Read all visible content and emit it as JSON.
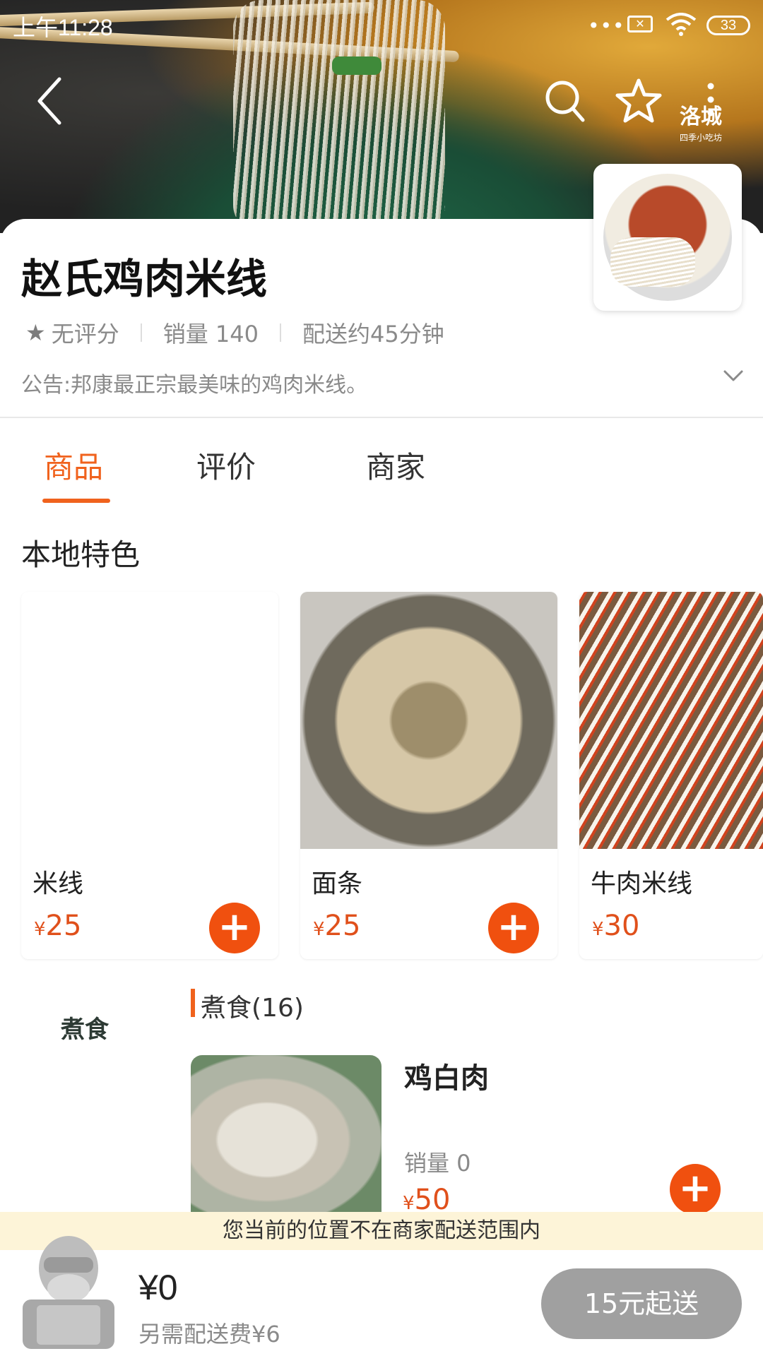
{
  "status_bar": {
    "time": "上午11:28",
    "battery": "33"
  },
  "header": {
    "brand_logo_text": "洛城",
    "brand_logo_sub": "四季小吃坊"
  },
  "store": {
    "name": "赵氏鸡肉米线",
    "rating": "无评分",
    "sales": "销量 140",
    "delivery_time": "配送约45分钟",
    "notice": "公告:邦康最正宗最美味的鸡肉米线。"
  },
  "tabs": [
    {
      "label": "商品",
      "active": true
    },
    {
      "label": "评价",
      "active": false
    },
    {
      "label": "商家",
      "active": false
    }
  ],
  "featured": {
    "title": "本地特色",
    "items": [
      {
        "name": "米线",
        "currency": "¥",
        "price": "25"
      },
      {
        "name": "面条",
        "currency": "¥",
        "price": "25"
      },
      {
        "name": "牛肉米线",
        "currency": "¥",
        "price": "30"
      }
    ]
  },
  "menu": {
    "sidebar": [
      {
        "label": "煮食"
      }
    ],
    "category_title": "煮食(16)",
    "items": [
      {
        "name": "鸡白肉",
        "sales": "销量 0",
        "currency": "¥",
        "price": "50"
      }
    ]
  },
  "cart": {
    "range_notice": "您当前的位置不在商家配送范围内",
    "total": "¥0",
    "extra_fee": "另需配送费¥6",
    "checkout_label": "15元起送"
  },
  "colors": {
    "accent": "#f0621d",
    "price": "#e0501b",
    "checkout_disabled": "#a0a0a0",
    "notice_bg": "#fdf4d8"
  }
}
